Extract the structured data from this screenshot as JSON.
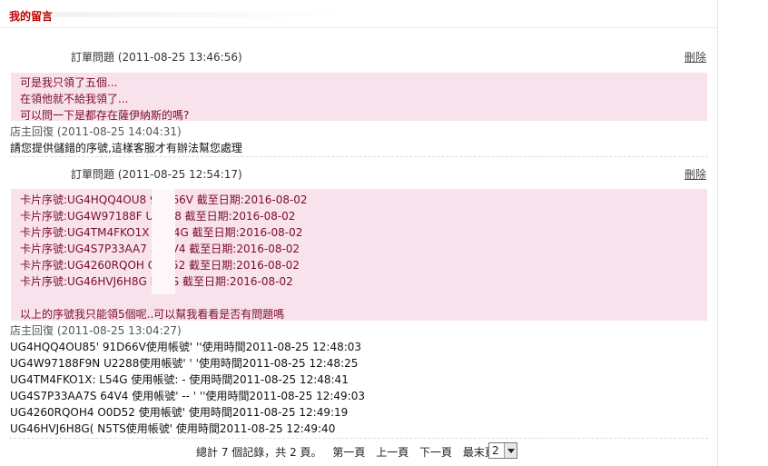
{
  "header": {
    "title": "我的留言"
  },
  "messages": [
    {
      "subject": "訂單問題",
      "time": "(2011-08-25 13:46:56)",
      "delete_label": "刪除",
      "lines": [
        "可是我只領了五個...",
        "在領他就不給我領了...",
        "可以問一下是都存在薩伊納斯的嗎?"
      ],
      "reply_label": "店主回復",
      "reply_time": "(2011-08-25 14:04:31)",
      "reply_lines": [
        "請您提供儲錯的序號,這樣客服才有辦法幫您處理"
      ]
    },
    {
      "subject": "訂單問題",
      "time": "(2011-08-25 12:54:17)",
      "delete_label": "刪除",
      "lines": [
        "卡片序號:UG4HQQ4OU8        91D66V 截至日期:2016-08-02",
        "卡片序號:UG4W97188F        U2288 截至日期:2016-08-02",
        "卡片序號:UG4TM4FKO1X       XL54G 截至日期:2016-08-02",
        "卡片序號:UG4S7P33AA7       364V4 截至日期:2016-08-02",
        "卡片序號:UG4260RQOH        O0D52 截至日期:2016-08-02",
        "卡片序號:UG46HVJ6H8G       N5TS 截至日期:2016-08-02",
        "",
        "以上的序號我只能領5個呢..可以幫我看看是否有問題嗎"
      ],
      "reply_label": "店主回復",
      "reply_time": "(2011-08-25 13:04:27)",
      "reply_lines": [
        "UG4HQQ4OU85'  91D66V使用帳號'          ''使用時間2011-08-25 12:48:03",
        "UG4W97188F9N  U2288使用帳號'           ' '使用時間2011-08-25 12:48:25",
        "UG4TM4FKO1X:  L54G 使用帳號:        -   使用時間2011-08-25 12:48:41",
        "UG4S7P33AA7S  64V4 使用帳號'   --  ' ''使用時間2011-08-25 12:49:03",
        "UG4260RQOH4   O0D52 使用帳號'           使用時間2011-08-25 12:49:19",
        "UG46HVJ6H8G(  N5TS使用帳號'            使用時間2011-08-25 12:49:40"
      ]
    }
  ],
  "pager": {
    "summary": "總計 7 個記錄，共 2 頁。",
    "first": "第一頁",
    "prev": "上一頁",
    "next": "下一頁",
    "last": "最末頁",
    "current_page": "2"
  }
}
